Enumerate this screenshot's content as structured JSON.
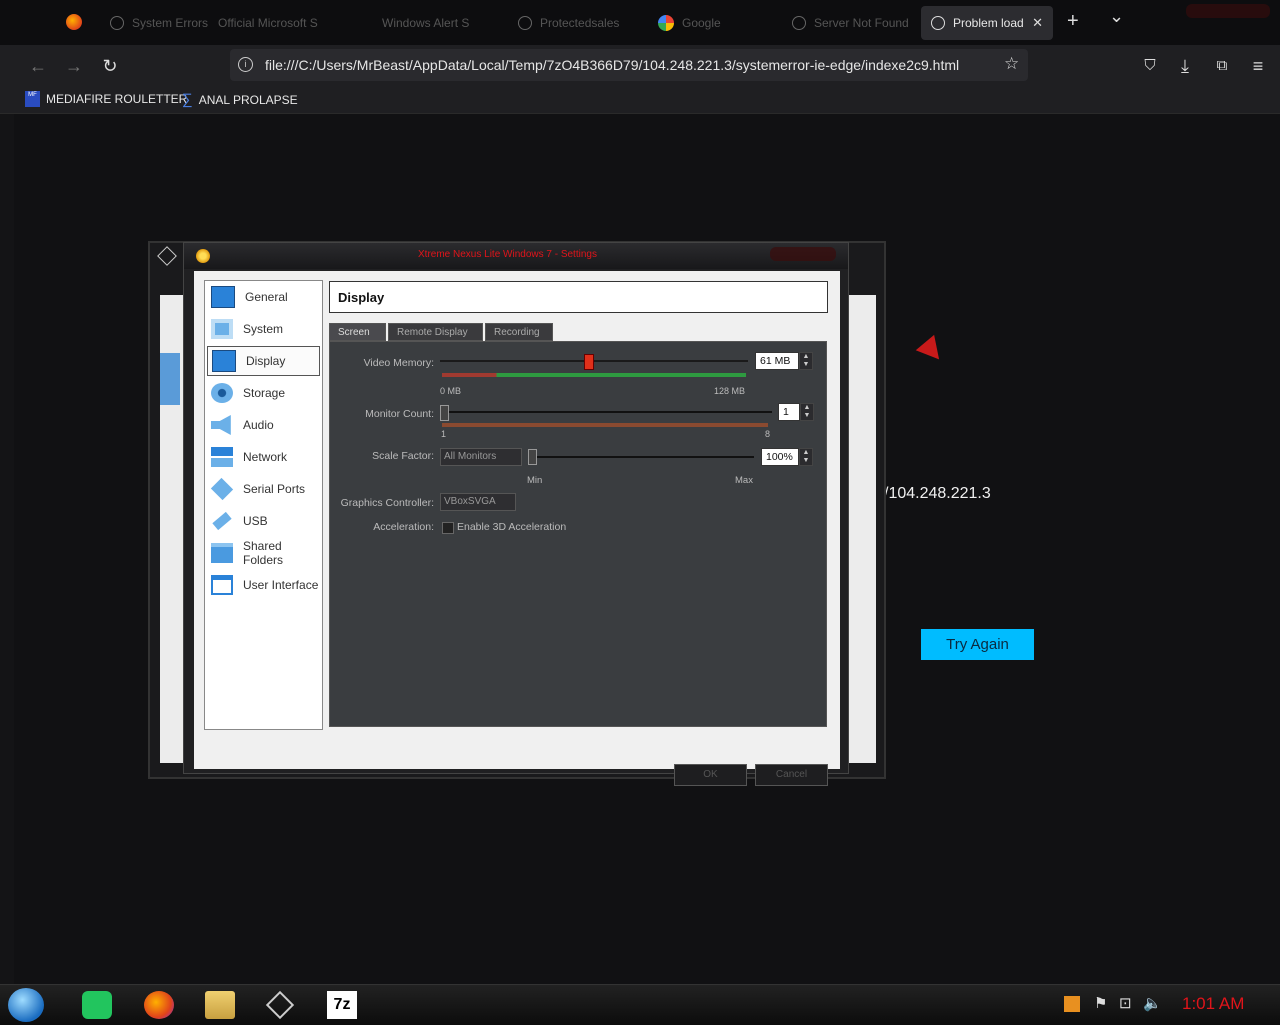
{
  "browser": {
    "tabs": [
      {
        "label": "System Errors"
      },
      {
        "label": "Official Microsoft S"
      },
      {
        "label": "Windows Alert S"
      },
      {
        "label": "Protectedsales"
      },
      {
        "label": "Google"
      },
      {
        "label": "Server Not Found"
      },
      {
        "label": "Problem loadi",
        "active": true
      }
    ],
    "new_tab": "+",
    "tab_list": "⌄",
    "url": "file:///C:/Users/MrBeast/AppData/Local/Temp/7zO4B366D79/104.248.221.3/systemerror-ie-edge/indexe2c9.html",
    "bookmarks": [
      {
        "label": "MEDIAFIRE ROULETTER",
        "icon": "mf-icon"
      },
      {
        "label": "ANAL PROLAPSE",
        "icon": "sigma-icon"
      }
    ]
  },
  "page": {
    "ip_text": "/104.248.221.3",
    "try_again_label": "Try Again"
  },
  "dialog": {
    "title": "Xtreme Nexus Lite Windows 7 - Settings",
    "categories": [
      {
        "label": "General"
      },
      {
        "label": "System"
      },
      {
        "label": "Display",
        "selected": true
      },
      {
        "label": "Storage"
      },
      {
        "label": "Audio"
      },
      {
        "label": "Network"
      },
      {
        "label": "Serial Ports"
      },
      {
        "label": "USB"
      },
      {
        "label": "Shared Folders"
      },
      {
        "label": "User Interface"
      }
    ],
    "panel_title": "Display",
    "subtabs": [
      "Screen",
      "Remote Display",
      "Recording"
    ],
    "video_memory": {
      "label": "Video Memory:",
      "value": "61 MB",
      "min": "0 MB",
      "max": "128 MB",
      "level": 0.48
    },
    "monitor_count": {
      "label": "Monitor Count:",
      "value": "1",
      "min": "1",
      "max": "8"
    },
    "scale_factor": {
      "label": "Scale Factor:",
      "combo": "All Monitors",
      "value": "100%",
      "min": "Min",
      "max": "Max"
    },
    "graphics_controller": {
      "label": "Graphics Controller:",
      "value": "VBoxSVGA"
    },
    "acceleration": {
      "label": "Acceleration:",
      "checkbox": "Enable 3D Acceleration"
    },
    "ok_label": "OK",
    "cancel_label": "Cancel"
  },
  "taskbar": {
    "clock": "1:01 AM",
    "sevenzip_label": "7z"
  },
  "colors": {
    "accent_red": "#e0141a",
    "try_again_bg": "#00bcff"
  }
}
